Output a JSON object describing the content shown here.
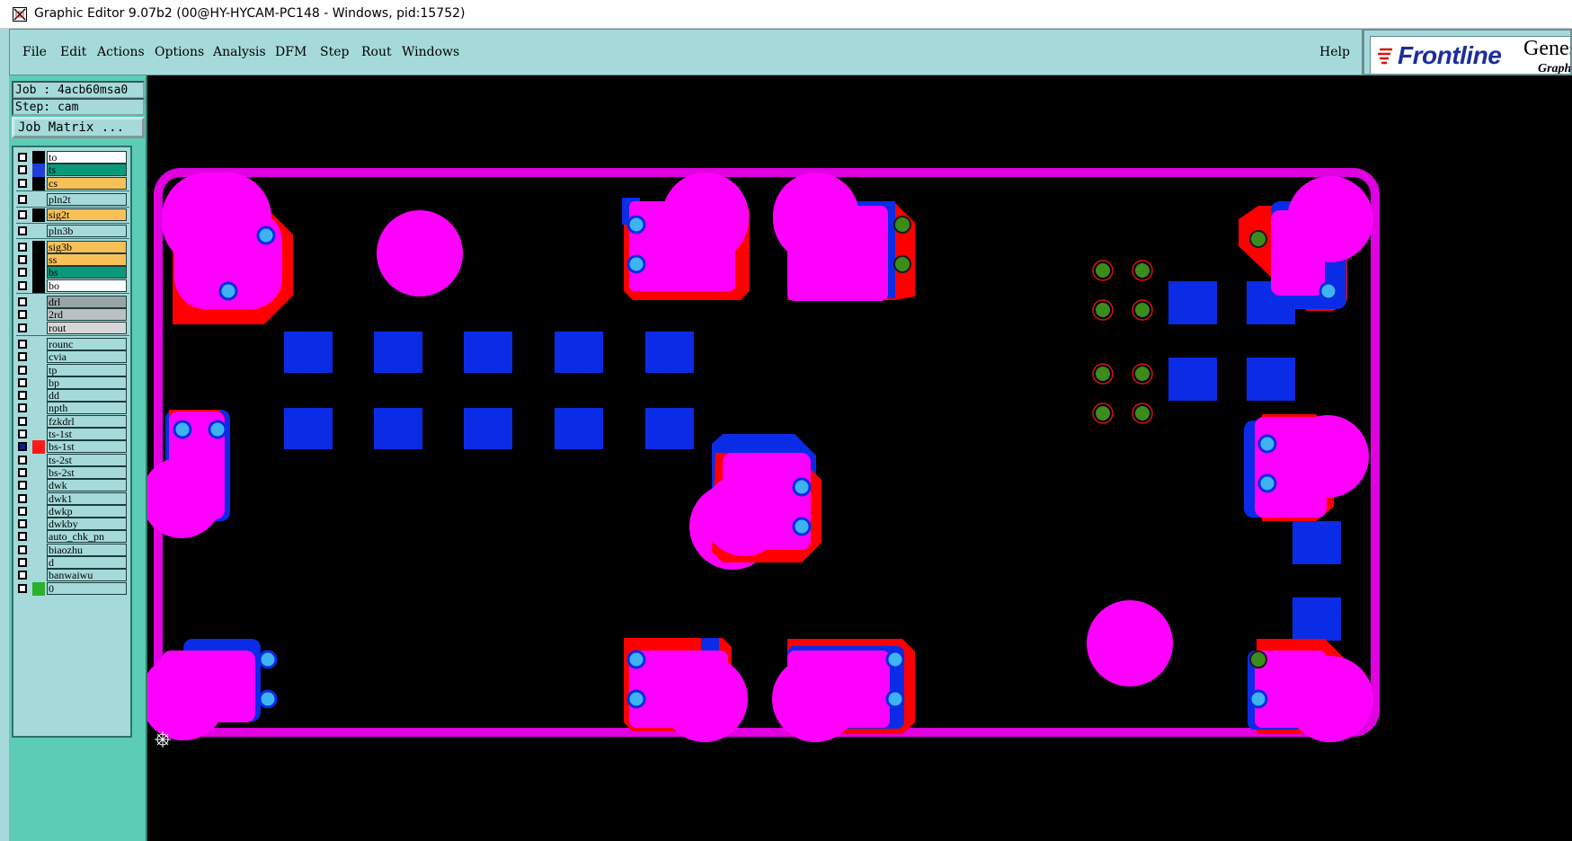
{
  "window": {
    "title": "Graphic Editor 9.07b2 (00@HY-HYCAM-PC148 - Windows, pid:15752)"
  },
  "menu": {
    "items": [
      "File",
      "Edit",
      "Actions",
      "Options",
      "Analysis",
      "DFM",
      "Step",
      "Rout",
      "Windows"
    ],
    "help": "Help"
  },
  "logo": {
    "brand": "Frontline",
    "product": "Genes",
    "tagline": "Graphi"
  },
  "side": {
    "job": "Job : 4acb60msa0",
    "step": "Step: cam",
    "job_matrix": "Job Matrix ..."
  },
  "layers": [
    {
      "name": "to",
      "box": "#000000",
      "fill": "#ffffff"
    },
    {
      "name": "ts",
      "box": "#1f3fd6",
      "fill": "#0a9a7a"
    },
    {
      "name": "cs",
      "box": "#000000",
      "fill": "#f7c157"
    },
    {
      "name": "pln2t",
      "box": "",
      "fill": "#a6dada"
    },
    {
      "name": "sig2t",
      "box": "#000000",
      "fill": "#f7c157"
    },
    {
      "name": "pln3b",
      "box": "",
      "fill": "#a6dada"
    },
    {
      "name": "sig3b",
      "box": "#000000",
      "fill": "#f7c157"
    },
    {
      "name": "ss",
      "box": "#000000",
      "fill": "#f7c157"
    },
    {
      "name": "bs",
      "box": "#000000",
      "fill": "#0a9a7a"
    },
    {
      "name": "bo",
      "box": "#000000",
      "fill": "#ffffff"
    },
    {
      "name": "drl",
      "box": "",
      "fill": "#9aa4a4"
    },
    {
      "name": "2rd",
      "box": "",
      "fill": "#b9c2c2"
    },
    {
      "name": "rout",
      "box": "",
      "fill": "#d6d6d6"
    },
    {
      "name": "rounc",
      "box": "",
      "fill": "#a6dada"
    },
    {
      "name": "cvia",
      "box": "",
      "fill": "#a6dada"
    },
    {
      "name": "tp",
      "box": "",
      "fill": "#a6dada"
    },
    {
      "name": "bp",
      "box": "",
      "fill": "#a6dada"
    },
    {
      "name": "dd",
      "box": "",
      "fill": "#a6dada"
    },
    {
      "name": "npth",
      "box": "",
      "fill": "#a6dada"
    },
    {
      "name": "fzkdrl",
      "box": "",
      "fill": "#a6dada"
    },
    {
      "name": "ts-1st",
      "box": "",
      "fill": "#a6dada"
    },
    {
      "name": "bs-1st",
      "box": "#ff1a1a",
      "fill": "#a6dada"
    },
    {
      "name": "ts-2st",
      "box": "",
      "fill": "#a6dada"
    },
    {
      "name": "bs-2st",
      "box": "",
      "fill": "#a6dada"
    },
    {
      "name": "dwk",
      "box": "",
      "fill": "#a6dada"
    },
    {
      "name": "dwk1",
      "box": "",
      "fill": "#a6dada"
    },
    {
      "name": "dwkp",
      "box": "",
      "fill": "#a6dada"
    },
    {
      "name": "dwkby",
      "box": "",
      "fill": "#a6dada"
    },
    {
      "name": "auto_chk_pn",
      "box": "",
      "fill": "#a6dada"
    },
    {
      "name": "biaozhu",
      "box": "",
      "fill": "#a6dada"
    },
    {
      "name": "d",
      "box": "",
      "fill": "#a6dada"
    },
    {
      "name": "banwaiwu",
      "box": "",
      "fill": "#a6dada"
    },
    {
      "name": "0",
      "box": "#2bb02b",
      "fill": "#a6dada"
    }
  ],
  "colors": {
    "outline": "#e000e0",
    "pad_top": "#ff00ff",
    "pad_red": "#ff0000",
    "pad_blue": "#0a2ce6",
    "via": "#3fb3f2",
    "drill": "#3c8c1c"
  }
}
